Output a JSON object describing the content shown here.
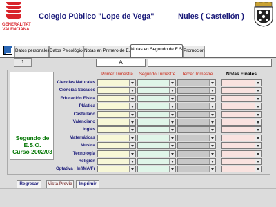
{
  "header": {
    "logo_text_1": "GENERALITAT",
    "logo_text_2": "VALENCIANA",
    "title": "Colegio Público \"Lope de Vega\"",
    "location": "Nules ( Castellón )"
  },
  "tabs": [
    {
      "label": "Datos personales"
    },
    {
      "label": "Datos Psicológicos"
    },
    {
      "label": "Notas en Primero de E.S.O."
    },
    {
      "label": "Notas en Segundo de E.S.O."
    },
    {
      "label": "Promoción"
    }
  ],
  "active_tab_index": 3,
  "form": {
    "record_number": "1",
    "group_value": "A"
  },
  "side_panel": {
    "line1": "Segundo de",
    "line2": "E.S.O.",
    "line3": "Curso 2002/03"
  },
  "columns": {
    "t1": "Primer Trimestre",
    "t2": "Segundo Trimestre",
    "t3": "Tercer Trimestre",
    "final": "Notas Finales"
  },
  "subjects": [
    "Ciencias Naturales",
    "Ciencias Sociales",
    "Educación Física",
    "Plástica",
    "Castellano",
    "Valenciano",
    "Inglés",
    "Matemáticas",
    "Música",
    "Tecnología",
    "Religión",
    "Optativa : Inf/MA/Fr"
  ],
  "buttons": {
    "back": "Regresar",
    "preview": "Vista Previa",
    "print": "Imprimir"
  },
  "colors": {
    "title": "#1a1a7a",
    "trimester_header": "#cc2a1a",
    "side_text": "#0a7a0a",
    "t1_bg": "#f7f7d6",
    "t2_bg": "#dff5e8",
    "t3_bg": "#c8c8c8",
    "final_bg": "#f9e2df"
  }
}
